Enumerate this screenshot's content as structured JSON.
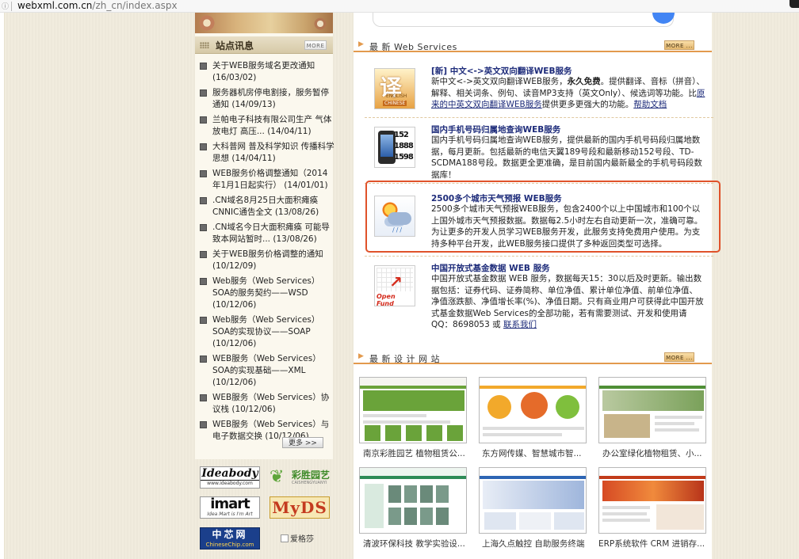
{
  "browser": {
    "url_host": "webxml.com.cn",
    "url_path": "/zh_cn/index.aspx"
  },
  "news": {
    "title": "站点讯息",
    "more_label": "MORE",
    "items": [
      {
        "text": "关于WEB服务域名更改通知",
        "date": "(16/03/02)"
      },
      {
        "text": "服务器机房停电割接，服务暂停通知",
        "date": "(14/09/13)"
      },
      {
        "text": "兰帕电子科技有限公司生产 气体放电灯 高压...",
        "date": "(14/04/11)"
      },
      {
        "text": "大科普网 普及科学知识 传播科学思想",
        "date": "(14/04/11)"
      },
      {
        "text": "WEB服务价格调整通知（2014年1月1日起实行）",
        "date": "(14/01/01)"
      },
      {
        "text": ".CN域名8月25日大面积瘫痪 CNNIC通告全文",
        "date": "(13/08/26)"
      },
      {
        "text": ".CN域名今日大面积瘫痪 可能导致本网站暂时...",
        "date": "(13/08/26)"
      },
      {
        "text": "关于WEB服务价格调整的通知",
        "date": "(10/12/09)"
      },
      {
        "text": "Web服务（Web Services）SOA的服务契约——WSD",
        "date": "(10/12/06)"
      },
      {
        "text": "Web服务（Web Services）SOA的实现协议——SOAP",
        "date": "(10/12/06)"
      },
      {
        "text": "WEB服务（Web Services）SOA的实现基础——XML",
        "date": "(10/12/06)"
      },
      {
        "text": "WEB服务（Web Services）协议栈",
        "date": "(10/12/06)"
      },
      {
        "text": "WEB服务（Web Services）与电子数据交换",
        "date": "(10/12/06)"
      }
    ],
    "more_link": "更多 >>"
  },
  "logos": {
    "ideabody": {
      "name": "Ideabody",
      "sub": "www.ideabody.com"
    },
    "caisheng": {
      "name": "彩胜园艺",
      "sub": "CAISHENGYUANYI"
    },
    "imart": {
      "name": "imart",
      "sub": "Idea Mart is I'm Art"
    },
    "myds": {
      "name": "MyDS"
    },
    "chinesechip": {
      "name": "中芯网",
      "sub": "ChineseChip.com"
    },
    "aigesha": {
      "name": "爱格莎"
    }
  },
  "ws": {
    "title": "最 新 Web Services",
    "more_label": "MORE ...",
    "items": [
      {
        "title": "[新] 中文<->英文双向翻译WEB服务",
        "desc_pre": "新中文<->英文双向翻译WEB服务，",
        "desc_bold": "永久免费",
        "desc_post": "。提供翻译、音标（拼音）、解释、相关词条、例句、读音MP3支持（英文Only）、候选词等功能。比",
        "link1": "原来的中英文双向翻译WEB服务",
        "desc_mid": "提供更多更强大的功能。",
        "link2": "帮助文档",
        "icon_big": "译",
        "icon_t1": "ENGLISH",
        "icon_t2": "CHINESE"
      },
      {
        "title": "国内手机号码归属地查询WEB服务",
        "desc": "国内手机号码归属地查询WEB服务，提供最新的国内手机号码段归属地数据，每月更新。包括最新的电信天翼189号段和最新移动152号段、TD-SCDMA188号段。数据更全更准确，是目前国内最新最全的手机号码段数据库！",
        "icon_n1": "152",
        "icon_n2": "1888",
        "icon_n3": "1598"
      },
      {
        "title": "2500多个城市天气预报 WEB服务",
        "desc": "2500多个城市天气预报WEB服务，包含2400个以上中国城市和100个以上国外城市天气预报数据。数据每2.5小时左右自动更新一次，准确可靠。为让更多的开发人员学习WEB服务开发，此服务支持免费用户使用。为支持多种平台开发，此WEB服务接口提供了多种返回类型可选择。"
      },
      {
        "title": "中国开放式基金数据 WEB 服务",
        "desc": "中国开放式基金数据 WEB 服务，数据每天15：30以后及时更新。输出数据包括：证券代码、证券简称、单位净值、累计单位净值、前单位净值、净值涨跌额、净值增长率(%)、净值日期。只有商业用户可获得此中国开放式基金数据Web Services的全部功能，若有需要测试、开发和使用请QQ：8698053 或",
        "link": "联系我们",
        "icon_t": "Open Fund"
      }
    ]
  },
  "design": {
    "title": "最 新 设 计 网 站",
    "more_label": "MORE ...",
    "sites": [
      {
        "caption": "南京彩胜园艺 植物租赁公...",
        "accent": "#6aa33a"
      },
      {
        "caption": "东方网传媒、智慧城市智...",
        "accent": "#f2a92b"
      },
      {
        "caption": "办公室绿化植物租赁、小...",
        "accent": "#4f8f36"
      },
      {
        "caption": "清波环保科技 教学实验设...",
        "accent": "#2e8b57"
      },
      {
        "caption": "上海久点触控 自助服务终端",
        "accent": "#2d65b4"
      },
      {
        "caption": "ERP系统软件 CRM 进销存...",
        "accent": "#c23b1a"
      }
    ]
  }
}
